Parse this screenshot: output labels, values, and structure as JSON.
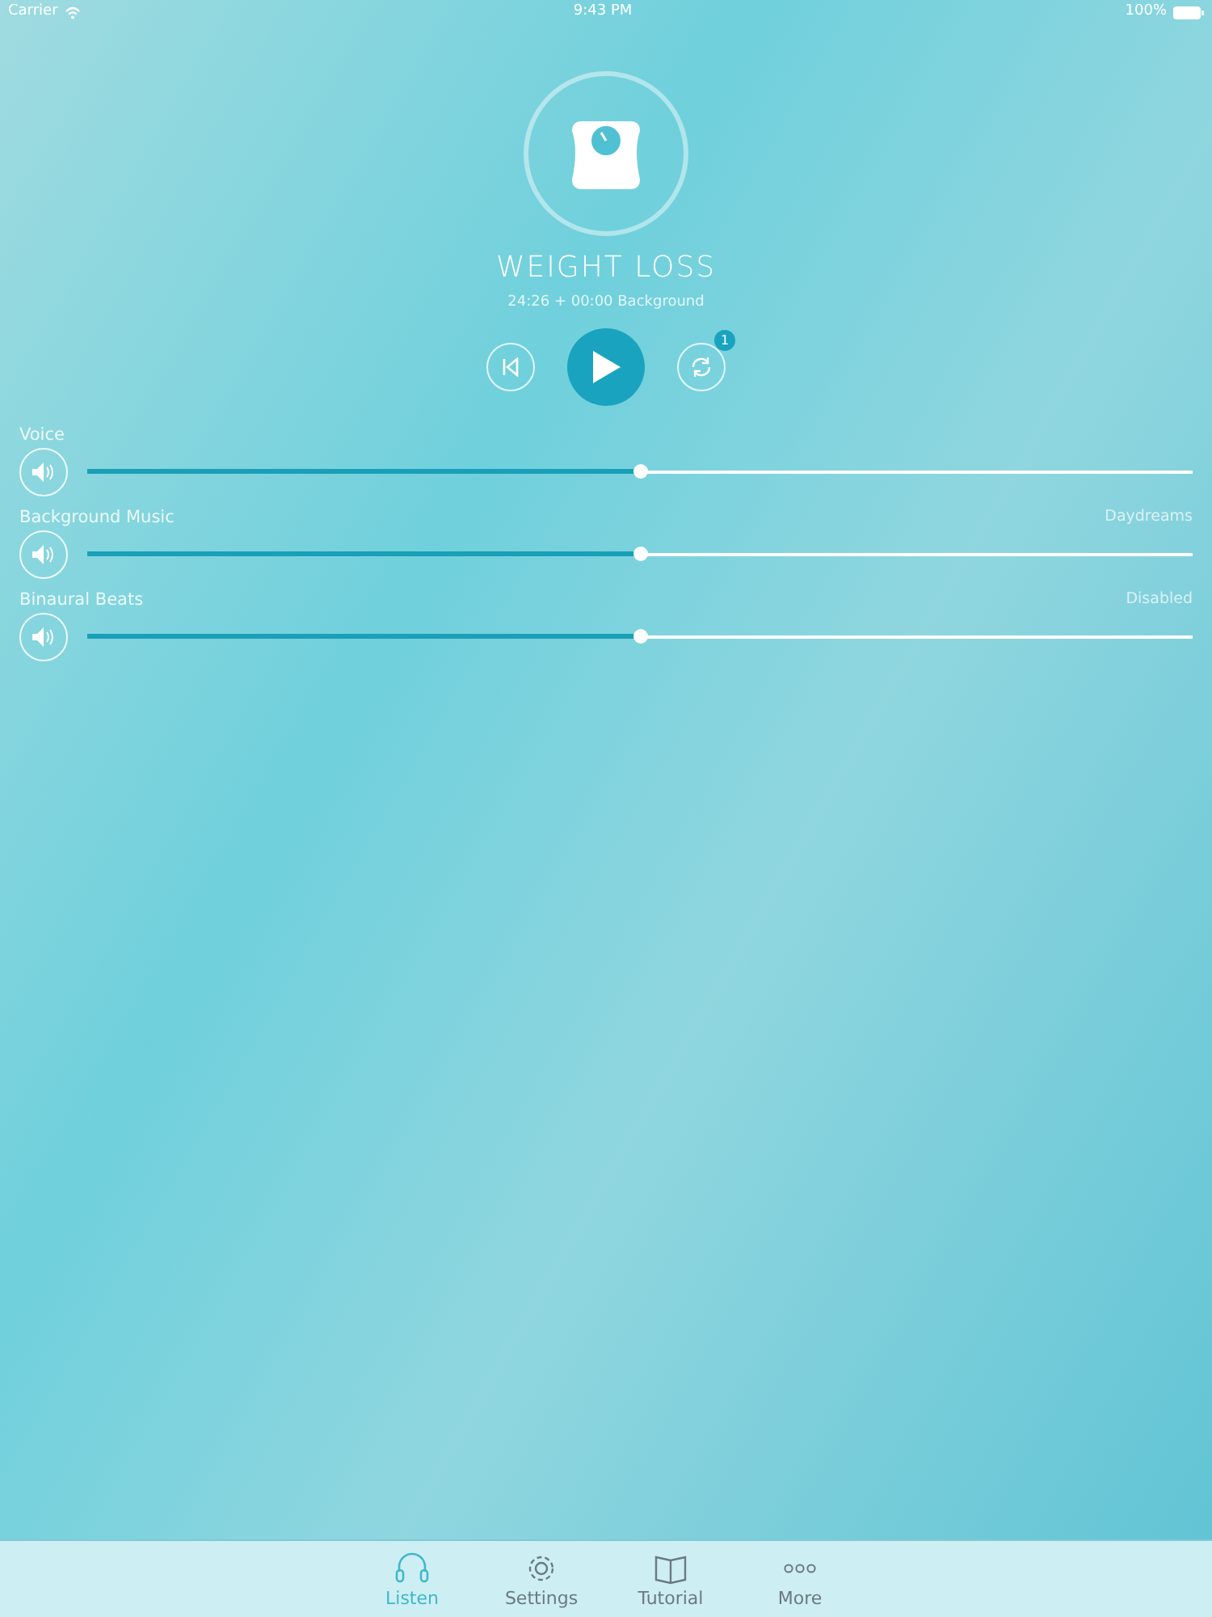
{
  "status_bar": {
    "carrier": "Carrier",
    "time": "9:43 PM",
    "battery": "100%"
  },
  "session": {
    "title": "WEIGHT LOSS",
    "subtitle": "24:26 + 00:00 Background"
  },
  "controls": {
    "repeat_badge": "1"
  },
  "channels": [
    {
      "name": "Voice",
      "level": 0.5
    },
    {
      "name": "Background Music",
      "value": "Daydreams",
      "level": 0.5
    },
    {
      "name": "Binaural Beats",
      "value": "Disabled",
      "level": 0.5
    }
  ],
  "tabs": [
    {
      "label": "Listen",
      "kind": "headphones",
      "selected": true
    },
    {
      "label": "Settings",
      "kind": "gear",
      "selected": false
    },
    {
      "label": "Tutorial",
      "kind": "book",
      "selected": false
    },
    {
      "label": "More",
      "kind": "dots",
      "selected": false
    }
  ]
}
